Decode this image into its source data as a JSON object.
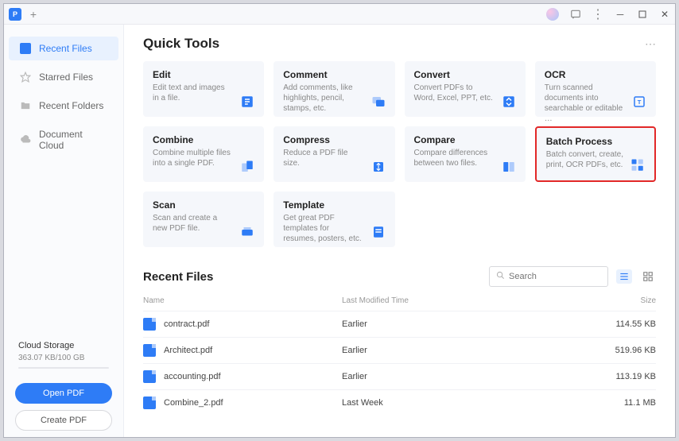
{
  "titlebar": {
    "app_initial": "P"
  },
  "sidebar": {
    "items": [
      {
        "label": "Recent Files",
        "active": true
      },
      {
        "label": "Starred Files",
        "active": false
      },
      {
        "label": "Recent Folders",
        "active": false
      },
      {
        "label": "Document Cloud",
        "active": false
      }
    ],
    "cloud": {
      "title": "Cloud Storage",
      "usage": "363.07 KB/100 GB"
    },
    "open_btn": "Open PDF",
    "create_btn": "Create PDF"
  },
  "quick_tools": {
    "heading": "Quick Tools",
    "cards": [
      {
        "title": "Edit",
        "desc": "Edit text and images in a file.",
        "highlight": false
      },
      {
        "title": "Comment",
        "desc": "Add comments, like highlights, pencil, stamps, etc.",
        "highlight": false
      },
      {
        "title": "Convert",
        "desc": "Convert PDFs to Word, Excel, PPT, etc.",
        "highlight": false
      },
      {
        "title": "OCR",
        "desc": "Turn scanned documents into searchable or editable …",
        "highlight": false
      },
      {
        "title": "Combine",
        "desc": "Combine multiple files into a single PDF.",
        "highlight": false
      },
      {
        "title": "Compress",
        "desc": "Reduce a PDF file size.",
        "highlight": false
      },
      {
        "title": "Compare",
        "desc": "Compare differences between two files.",
        "highlight": false
      },
      {
        "title": "Batch Process",
        "desc": "Batch convert, create, print, OCR PDFs, etc.",
        "highlight": true
      },
      {
        "title": "Scan",
        "desc": "Scan and create a new PDF file.",
        "highlight": false
      },
      {
        "title": "Template",
        "desc": "Get great PDF templates for resumes, posters, etc.",
        "highlight": false
      }
    ]
  },
  "recent": {
    "heading": "Recent Files",
    "search_placeholder": "Search",
    "columns": {
      "name": "Name",
      "time": "Last Modified Time",
      "size": "Size"
    },
    "rows": [
      {
        "name": "contract.pdf",
        "time": "Earlier",
        "size": "114.55 KB"
      },
      {
        "name": "Architect.pdf",
        "time": "Earlier",
        "size": "519.96 KB"
      },
      {
        "name": "accounting.pdf",
        "time": "Earlier",
        "size": "113.19 KB"
      },
      {
        "name": "Combine_2.pdf",
        "time": "Last Week",
        "size": "11.1 MB"
      }
    ]
  }
}
